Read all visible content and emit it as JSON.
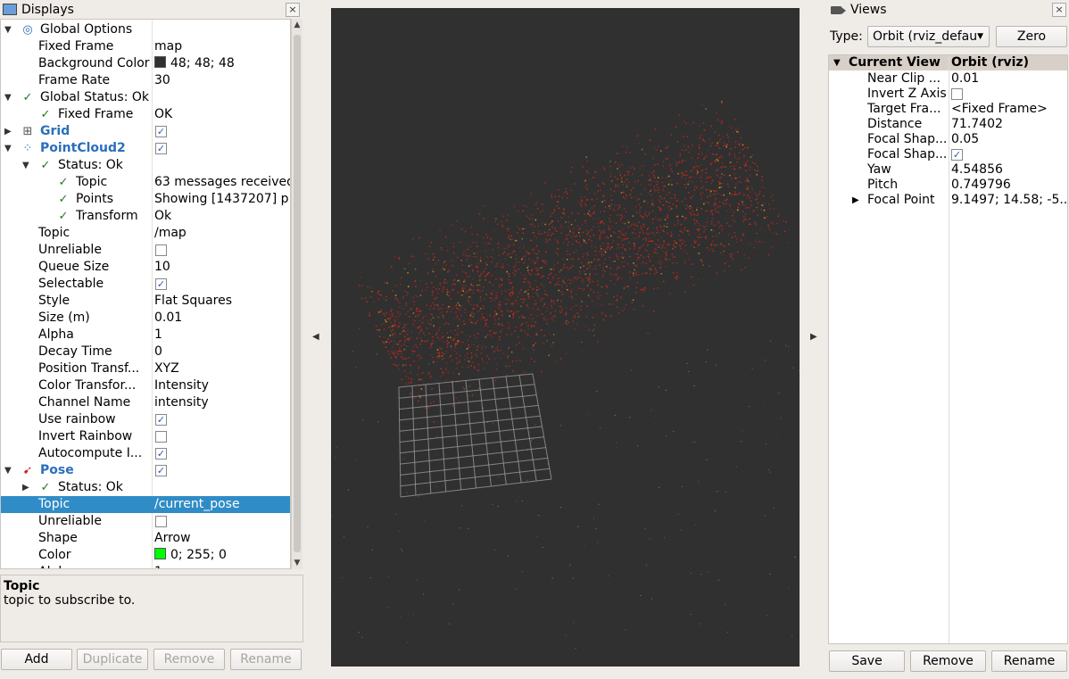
{
  "displays_panel": {
    "title": "Displays",
    "close": "×",
    "rows": [
      {
        "name": "Global Options",
        "value": ""
      },
      {
        "name": "Fixed Frame",
        "value": "map"
      },
      {
        "name": "Background Color",
        "value": "48; 48; 48"
      },
      {
        "name": "Frame Rate",
        "value": "30"
      },
      {
        "name": "Global Status: Ok",
        "value": ""
      },
      {
        "name": "Fixed Frame",
        "value": "OK"
      },
      {
        "name": "Grid",
        "value": ""
      },
      {
        "name": "PointCloud2",
        "value": ""
      },
      {
        "name": "Status: Ok",
        "value": ""
      },
      {
        "name": "Topic",
        "value": "63 messages received"
      },
      {
        "name": "Points",
        "value": "Showing [1437207] p..."
      },
      {
        "name": "Transform",
        "value": "Ok"
      },
      {
        "name": "Topic",
        "value": "/map"
      },
      {
        "name": "Unreliable",
        "value": ""
      },
      {
        "name": "Queue Size",
        "value": "10"
      },
      {
        "name": "Selectable",
        "value": ""
      },
      {
        "name": "Style",
        "value": "Flat Squares"
      },
      {
        "name": "Size (m)",
        "value": "0.01"
      },
      {
        "name": "Alpha",
        "value": "1"
      },
      {
        "name": "Decay Time",
        "value": "0"
      },
      {
        "name": "Position Transf...",
        "value": "XYZ"
      },
      {
        "name": "Color Transfor...",
        "value": "Intensity"
      },
      {
        "name": "Channel Name",
        "value": "intensity"
      },
      {
        "name": "Use rainbow",
        "value": ""
      },
      {
        "name": "Invert Rainbow",
        "value": ""
      },
      {
        "name": "Autocompute I...",
        "value": ""
      },
      {
        "name": "Pose",
        "value": ""
      },
      {
        "name": "Status: Ok",
        "value": ""
      },
      {
        "name": "Topic",
        "value": "/current_pose"
      },
      {
        "name": "Unreliable",
        "value": ""
      },
      {
        "name": "Shape",
        "value": "Arrow"
      },
      {
        "name": "Color",
        "value": "0; 255; 0"
      },
      {
        "name": "Alpha",
        "value": "1"
      }
    ],
    "checkmark": "✓",
    "background_color_hex": "#303030",
    "pose_color_hex": "#00ff00",
    "description": {
      "title": "Topic",
      "text": "topic to subscribe to."
    },
    "buttons": {
      "add": "Add",
      "duplicate": "Duplicate",
      "remove": "Remove",
      "rename": "Rename"
    }
  },
  "views_panel": {
    "title": "Views",
    "close": "×",
    "type_label": "Type:",
    "type_value": "Orbit (rviz_defau",
    "zero_button": "Zero",
    "header": {
      "name": "Current View",
      "value": "Orbit (rviz)"
    },
    "rows": [
      {
        "name": "Near Clip ...",
        "value": "0.01"
      },
      {
        "name": "Invert Z Axis",
        "value": ""
      },
      {
        "name": "Target Fra...",
        "value": "<Fixed Frame>"
      },
      {
        "name": "Distance",
        "value": "71.7402"
      },
      {
        "name": "Focal Shap...",
        "value": "0.05"
      },
      {
        "name": "Focal Shap...",
        "value": ""
      },
      {
        "name": "Yaw",
        "value": "4.54856"
      },
      {
        "name": "Pitch",
        "value": "0.749796"
      },
      {
        "name": "Focal Point",
        "value": "9.1497; 14.58; -5..."
      }
    ],
    "buttons": {
      "save": "Save",
      "remove": "Remove",
      "rename": "Rename"
    }
  },
  "viewport": {
    "background": "#303030",
    "point_color": "#c8281e",
    "highlight_color": "#d4a020",
    "grid_color": "#a0a0a0"
  }
}
